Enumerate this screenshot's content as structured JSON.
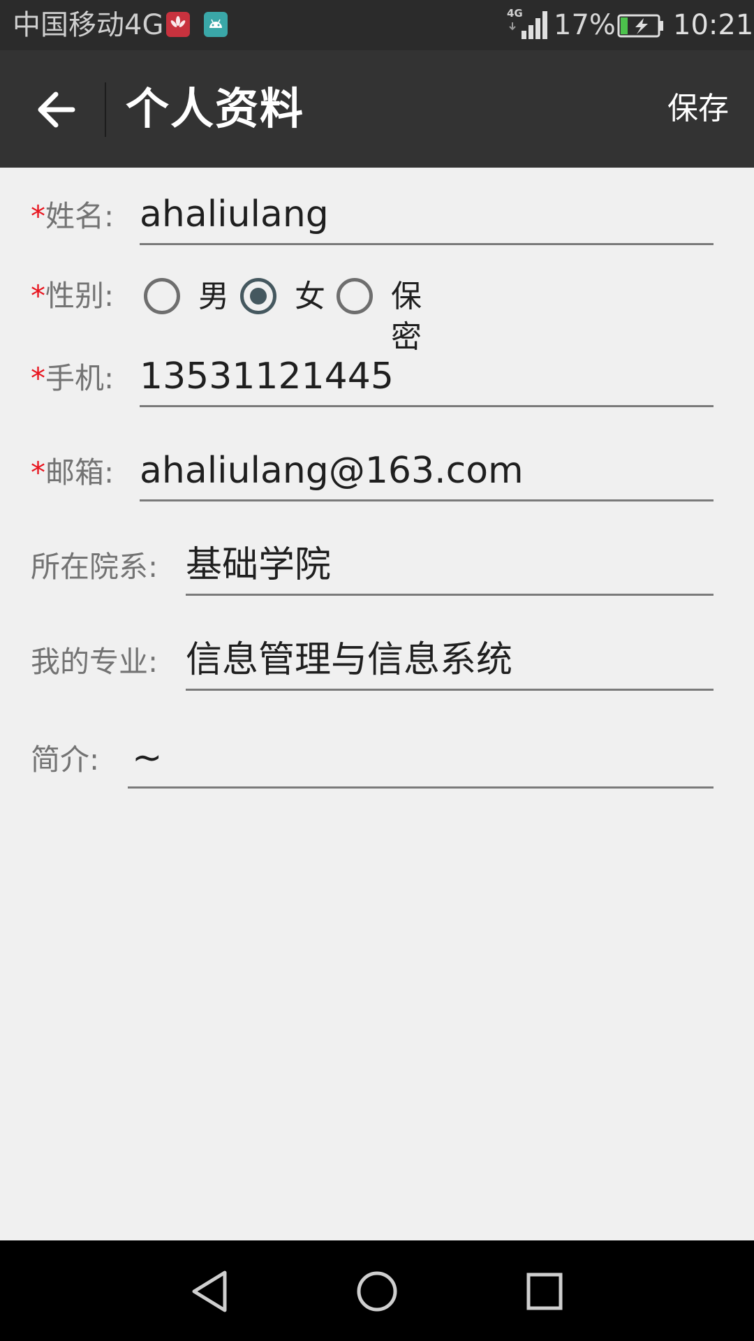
{
  "status_bar": {
    "carrier": "中国移动4G",
    "network_badge": "4G",
    "battery_percent": "17%",
    "time": "10:21",
    "icons": [
      "huawei-app-icon",
      "android-app-icon",
      "signal-icon",
      "battery-charging-icon"
    ]
  },
  "toolbar": {
    "title": "个人资料",
    "save_label": "保存",
    "back_icon": "arrow-left-icon"
  },
  "form": {
    "required_mark": "*",
    "name": {
      "label": "姓名:",
      "value": "ahaliulang"
    },
    "gender": {
      "label": "性别:",
      "options": [
        "男",
        "女",
        "保密"
      ],
      "selected": "女"
    },
    "phone": {
      "label": "手机:",
      "value": "13531121445"
    },
    "email": {
      "label": "邮箱:",
      "value": "ahaliulang@163.com"
    },
    "department": {
      "label": "所在院系:",
      "value": "基础学院"
    },
    "major": {
      "label": "我的专业:",
      "value": "信息管理与信息系统"
    },
    "bio": {
      "label": "简介:",
      "value": "~"
    }
  },
  "nav_bar": {
    "icons": [
      "back-triangle-icon",
      "home-circle-icon",
      "recents-square-icon"
    ]
  },
  "colors": {
    "toolbar_bg": "#333333",
    "status_bar_bg": "#2b2b2b",
    "page_bg": "#f0f0f0",
    "required": "#e8141e",
    "radio_checked": "#45585f"
  }
}
